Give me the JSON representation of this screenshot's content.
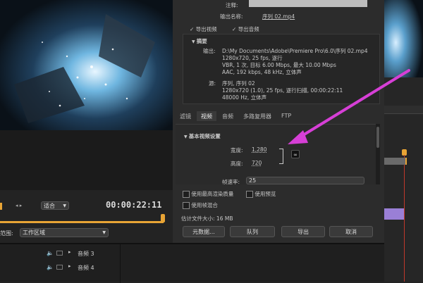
{
  "preview": {
    "fit_label": "适合",
    "timecode": "00:00:22:11",
    "range_label": "范围:",
    "range_value": "工作区域"
  },
  "export": {
    "comment_label": "注释:",
    "output_name_label": "输出名称:",
    "output_name_value": "序列 02.mp4",
    "export_video_label": "导出视频",
    "export_audio_label": "导出音频",
    "summary_title": "摘要",
    "output_label": "输出:",
    "output_lines": [
      "D:\\My Documents\\Adobe\\Premiere Pro\\6.0\\序列 02.mp4",
      "1280x720, 25 fps, 逐行",
      "VBR, 1 次, 目标 6.00 Mbps, 最大 10.00 Mbps",
      "AAC, 192 kbps, 48 kHz, 立体声"
    ],
    "source_label": "源:",
    "source_lines": [
      "序列, 序列 02",
      "1280x720 (1.0), 25 fps, 逐行扫描, 00:00:22:11",
      "48000 Hz, 立体声"
    ],
    "tabs": [
      "滤镜",
      "视频",
      "音频",
      "多路复用器",
      "FTP"
    ],
    "active_tab": 1,
    "basic_video_title": "基本视频设置",
    "width_label": "宽度:",
    "width_value": "1,280",
    "height_label": "高度:",
    "height_value": "720",
    "framerate_label": "帧速率:",
    "framerate_value": "25",
    "max_render_label": "使用最高渲染质量",
    "use_preview_label": "使用预览",
    "frame_blend_label": "使用帧混合",
    "filesize_label": "估计文件大小:",
    "filesize_value": "16 MB",
    "metadata_button": "元数据...",
    "queue_button": "队列",
    "export_button": "导出",
    "cancel_button": "取消"
  },
  "timeline": {
    "tracks": [
      "音频 3",
      "音频 4"
    ]
  },
  "colors": {
    "accent_orange": "#e8a435",
    "arrow_magenta": "#d63fd6",
    "clip_purple": "#9a7fd6"
  }
}
